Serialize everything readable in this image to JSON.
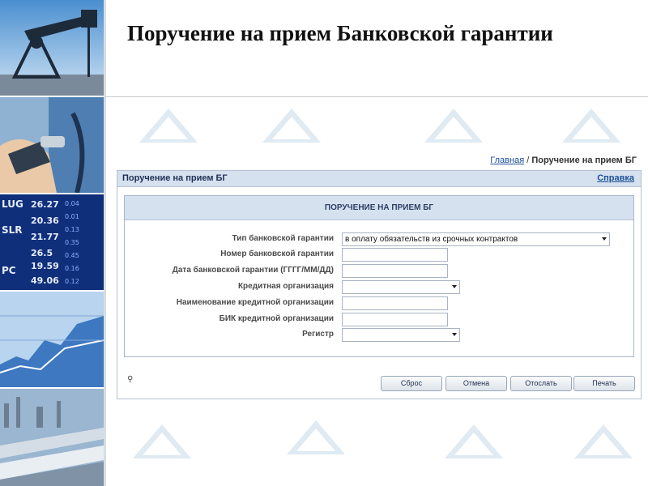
{
  "title": "Поручение на прием Банковской гарантии",
  "breadcrumb": {
    "home": "Главная",
    "separator": "/",
    "current": "Поручение на прием БГ"
  },
  "panel": {
    "title": "Поручение на прием БГ",
    "help_link": "Справка"
  },
  "form": {
    "header": "ПОРУЧЕНИЕ НА ПРИЕМ БГ",
    "fields": [
      {
        "label": "Тип банковской гарантии",
        "value": "в оплату обязательств из срочных контрактов",
        "kind": "select"
      },
      {
        "label": "Номер банковской гарантии",
        "value": "",
        "kind": "text"
      },
      {
        "label": "Дата банковской гарантии (ГГГГ/ММ/ДД)",
        "value": "",
        "kind": "text"
      },
      {
        "label": "Кредитная организация",
        "value": "",
        "kind": "select"
      },
      {
        "label": "Наименование кредитной организации",
        "value": "",
        "kind": "text"
      },
      {
        "label": "БИК кредитной организации",
        "value": "",
        "kind": "text"
      },
      {
        "label": "Регистр",
        "value": "",
        "kind": "select"
      }
    ]
  },
  "buttons": {
    "reset": "Сброс",
    "cancel": "Отмена",
    "send": "Отослать",
    "print": "Печать"
  },
  "ticker_numbers": [
    "26.27",
    "20.36",
    "21.77",
    "26.5",
    "19.59",
    "49.06"
  ],
  "ticker_codes": [
    "LUG",
    "SLR",
    "PC"
  ],
  "icons": {
    "pin": "pin-icon",
    "select_arrow": "chevron-down-icon",
    "logo": "triangle-logo-watermark"
  },
  "colors": {
    "panel_header": "#d6e1f0",
    "link": "#1d4f97",
    "border": "#b4c0d2"
  }
}
